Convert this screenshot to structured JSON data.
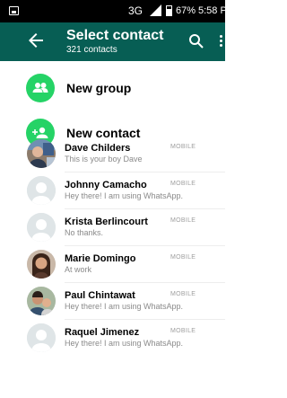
{
  "status_bar": {
    "network": "3G",
    "battery": "67%",
    "time": "5:58 P"
  },
  "header": {
    "title": "Select contact",
    "subtitle": "321 contacts",
    "accent_color": "#075e54"
  },
  "actions": [
    {
      "label": "New group",
      "icon": "group-add-icon"
    },
    {
      "label": "New contact",
      "icon": "person-add-icon"
    }
  ],
  "contacts": [
    {
      "name": "Dave Childers",
      "status": "This is your boy Dave",
      "type": "MOBILE",
      "avatar": "photo"
    },
    {
      "name": "Johnny Camacho",
      "status": "Hey there! I am using WhatsApp.",
      "type": "MOBILE",
      "avatar": "default"
    },
    {
      "name": "Krista Berlincourt",
      "status": "No thanks.",
      "type": "MOBILE",
      "avatar": "default"
    },
    {
      "name": "Marie Domingo",
      "status": "At work",
      "type": "MOBILE",
      "avatar": "photo"
    },
    {
      "name": "Paul Chintawat",
      "status": "Hey there! I am using WhatsApp.",
      "type": "MOBILE",
      "avatar": "photo"
    },
    {
      "name": "Raquel Jimenez",
      "status": "Hey there! I am using WhatsApp.",
      "type": "MOBILE",
      "avatar": "default"
    }
  ]
}
